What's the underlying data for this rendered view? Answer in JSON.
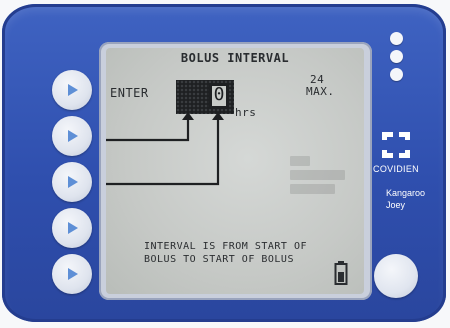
{
  "screen": {
    "title": "BOLUS INTERVAL",
    "prompt_label": "ENTER",
    "digit_value": "0",
    "unit_label": "hrs",
    "max_value": "24",
    "max_label": "MAX.",
    "note_line1": "INTERVAL IS FROM START OF",
    "note_line2": "BOLUS TO START OF BOLUS"
  },
  "brand": {
    "name": "COVIDIEN",
    "product_line1": "Kangaroo",
    "product_line2": "Joey"
  },
  "side_buttons": [
    {
      "icon": "play-arrow-icon"
    },
    {
      "icon": "play-arrow-icon"
    },
    {
      "icon": "play-arrow-icon"
    },
    {
      "icon": "play-arrow-icon"
    },
    {
      "icon": "play-arrow-icon"
    }
  ],
  "indicator_lights": [
    "indicator-light",
    "indicator-light",
    "indicator-light"
  ],
  "colors": {
    "housing": "#3457b7",
    "lcd": "#c9ccc9",
    "lcd_ink": "#2a2d30",
    "button": "#e4e8f0"
  }
}
